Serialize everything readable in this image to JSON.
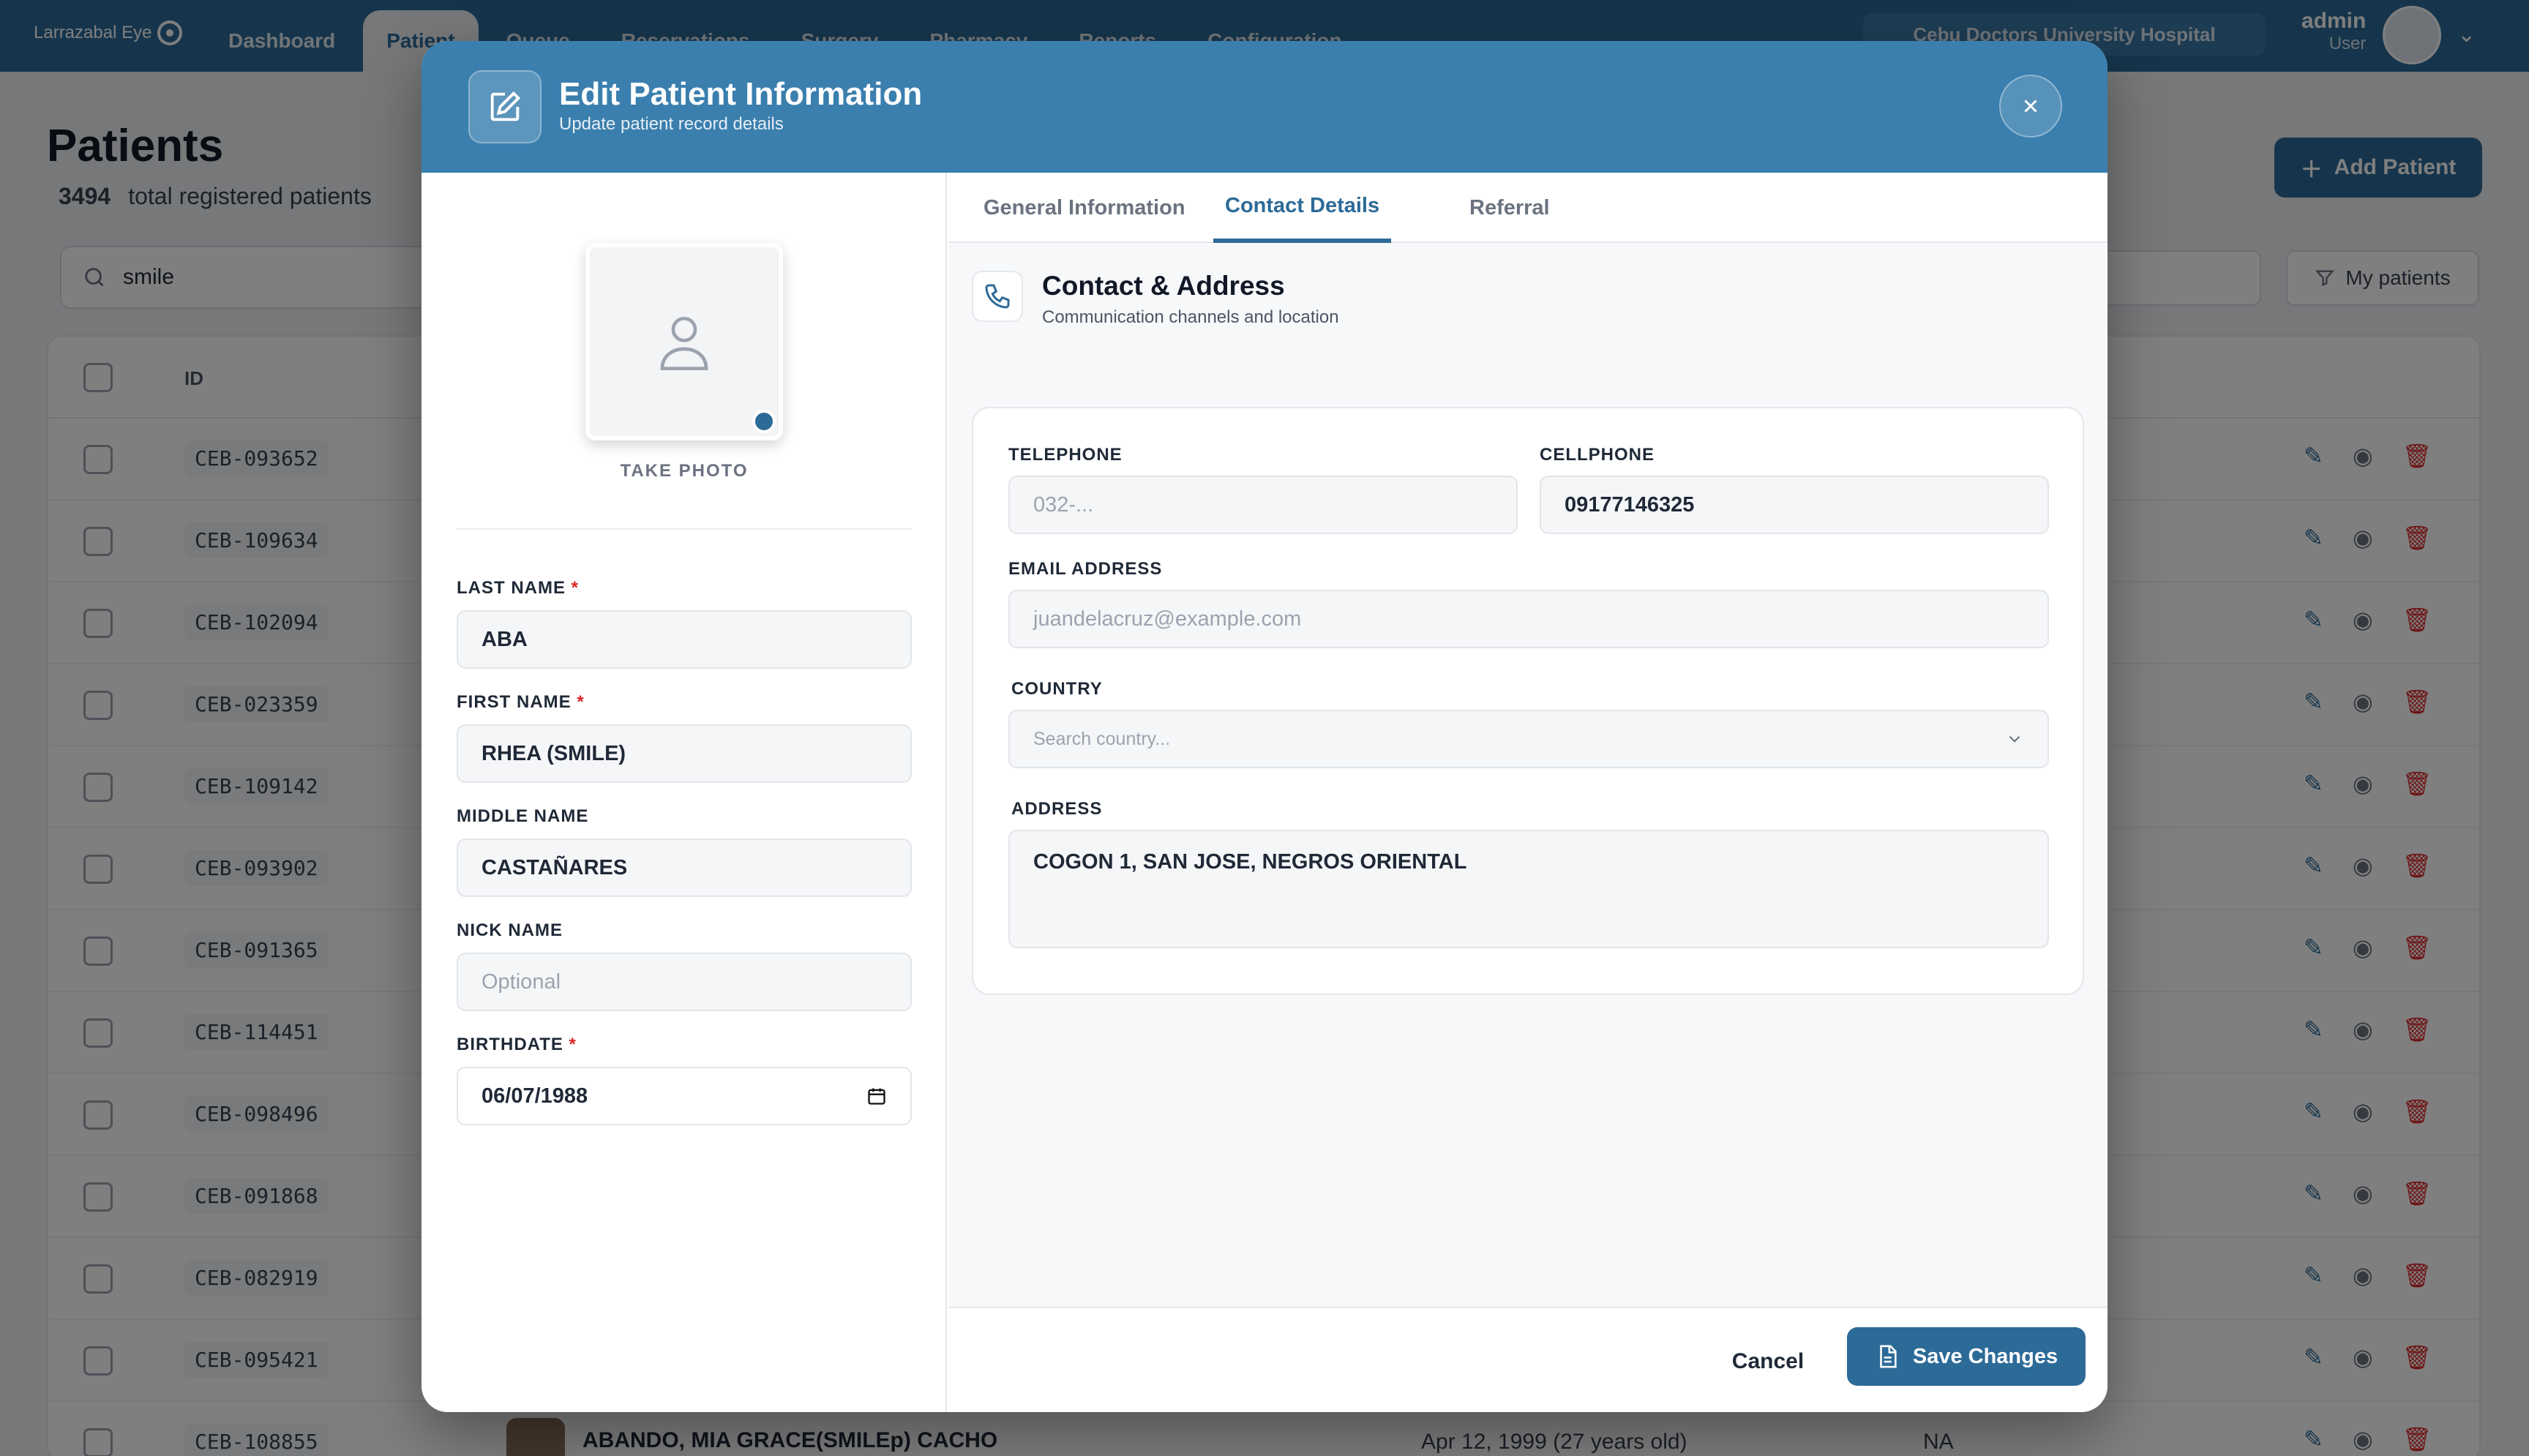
{
  "app": {
    "logo_text": "Larrazabal Eye"
  },
  "nav": {
    "tabs": [
      "Dashboard",
      "Patient",
      "Queue",
      "Reservations",
      "Surgery",
      "Pharmacy",
      "Reports",
      "Configuration"
    ],
    "active": "Patient"
  },
  "header": {
    "hospital": "Cebu Doctors University Hospital",
    "user_name": "admin",
    "user_role": "User"
  },
  "page": {
    "title": "Patients",
    "count": "3494",
    "count_label": "total registered patients",
    "add_button": "Add Patient",
    "search_value": "smile",
    "my_patients": "My patients"
  },
  "table": {
    "header_id": "ID",
    "rows": [
      {
        "id": "CEB-093652"
      },
      {
        "id": "CEB-109634"
      },
      {
        "id": "CEB-102094"
      },
      {
        "id": "CEB-023359"
      },
      {
        "id": "CEB-109142"
      },
      {
        "id": "CEB-093902"
      },
      {
        "id": "CEB-091365"
      },
      {
        "id": "CEB-114451"
      },
      {
        "id": "CEB-098496"
      },
      {
        "id": "CEB-091868"
      },
      {
        "id": "CEB-082919"
      },
      {
        "id": "CEB-095421"
      },
      {
        "id": "CEB-108855",
        "name": "ABANDO, MIA GRACE(SMILEp) CACHO",
        "birthdate": "Apr 12, 1999 (27 years old)",
        "extra": "NA"
      }
    ]
  },
  "modal": {
    "title": "Edit Patient Information",
    "subtitle": "Update patient record details",
    "take_photo": "TAKE PHOTO",
    "fields": {
      "last_name_label": "LAST NAME",
      "last_name": "ABA",
      "first_name_label": "FIRST NAME",
      "first_name": "RHEA (SMILE)",
      "middle_name_label": "MIDDLE NAME",
      "middle_name": "CASTAÑARES",
      "nick_name_label": "NICK NAME",
      "nick_name_placeholder": "Optional",
      "birthdate_label": "BIRTHDATE",
      "birthdate": "06/07/1988",
      "required_mark": "*"
    },
    "tabs": [
      "General Information",
      "Contact Details",
      "Referral"
    ],
    "active_tab": "Contact Details",
    "section": {
      "title": "Contact & Address",
      "subtitle": "Communication channels and location"
    },
    "contact": {
      "telephone_label": "TELEPHONE",
      "telephone_placeholder": "032-...",
      "cellphone_label": "CELLPHONE",
      "cellphone": "09177146325",
      "email_label": "EMAIL ADDRESS",
      "email_placeholder": "juandelacruz@example.com",
      "country_label": "COUNTRY",
      "country_placeholder": "Search country...",
      "address_label": "ADDRESS",
      "address": "COGON 1, SAN JOSE, NEGROS ORIENTAL"
    },
    "cancel": "Cancel",
    "save": "Save Changes"
  }
}
